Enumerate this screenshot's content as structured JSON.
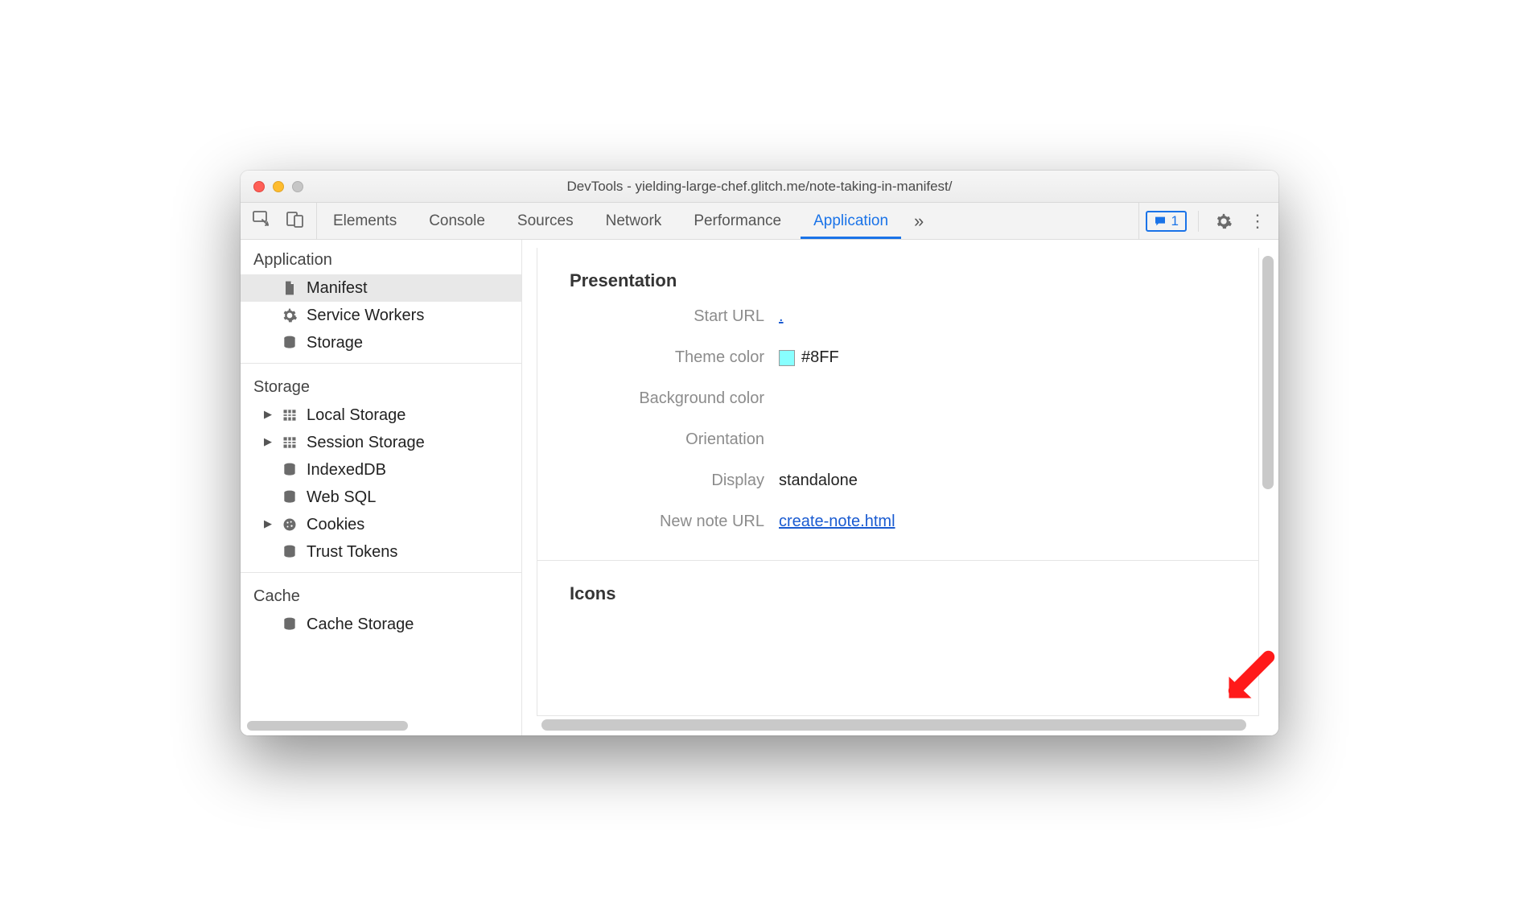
{
  "window": {
    "title": "DevTools - yielding-large-chef.glitch.me/note-taking-in-manifest/"
  },
  "tabs": {
    "items": [
      "Elements",
      "Console",
      "Sources",
      "Network",
      "Performance",
      "Application"
    ],
    "active_index": 5
  },
  "toolbar": {
    "issues_count": "1"
  },
  "sidebar": {
    "sections": {
      "application": {
        "label": "Application",
        "items": [
          {
            "label": "Manifest",
            "icon": "file"
          },
          {
            "label": "Service Workers",
            "icon": "gear"
          },
          {
            "label": "Storage",
            "icon": "db"
          }
        ],
        "selected_index": 0
      },
      "storage": {
        "label": "Storage",
        "items": [
          {
            "label": "Local Storage",
            "icon": "table",
            "expandable": true
          },
          {
            "label": "Session Storage",
            "icon": "table",
            "expandable": true
          },
          {
            "label": "IndexedDB",
            "icon": "db",
            "expandable": false
          },
          {
            "label": "Web SQL",
            "icon": "db",
            "expandable": false
          },
          {
            "label": "Cookies",
            "icon": "cookie",
            "expandable": true
          },
          {
            "label": "Trust Tokens",
            "icon": "db",
            "expandable": false
          }
        ]
      },
      "cache": {
        "label": "Cache",
        "items": [
          {
            "label": "Cache Storage",
            "icon": "db",
            "expandable": false
          }
        ]
      }
    }
  },
  "panel": {
    "presentation": {
      "title": "Presentation",
      "rows": {
        "start_url": {
          "key": "Start URL",
          "value": "."
        },
        "theme_color": {
          "key": "Theme color",
          "value": "#8FF",
          "swatch": "#88ffff"
        },
        "background_color": {
          "key": "Background color",
          "value": ""
        },
        "orientation": {
          "key": "Orientation",
          "value": ""
        },
        "display": {
          "key": "Display",
          "value": "standalone"
        },
        "new_note_url": {
          "key": "New note URL",
          "value": "create-note.html"
        }
      }
    },
    "icons": {
      "title": "Icons"
    }
  }
}
